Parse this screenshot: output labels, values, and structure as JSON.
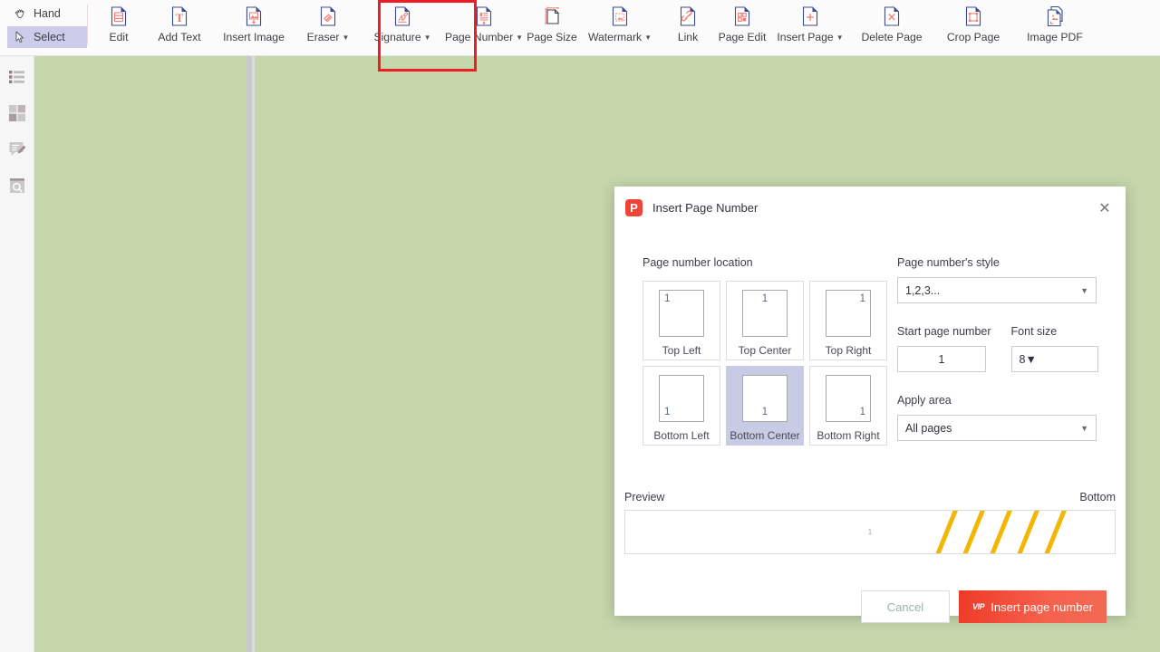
{
  "toolbar": {
    "modes": [
      {
        "label": "Hand",
        "icon": "hand-icon",
        "active": false
      },
      {
        "label": "Select",
        "icon": "cursor-arrow-icon",
        "active": true
      }
    ],
    "tools": [
      {
        "label": "Edit",
        "icon": "edit-document-icon",
        "caret": false
      },
      {
        "label": "Add Text",
        "icon": "add-text-icon",
        "caret": false
      },
      {
        "label": "Insert Image",
        "icon": "insert-image-icon",
        "caret": false
      },
      {
        "label": "Eraser",
        "icon": "eraser-icon",
        "caret": true
      },
      {
        "label": "Signature",
        "icon": "signature-icon",
        "caret": true
      },
      {
        "label": "Page Number",
        "icon": "page-number-icon",
        "caret": true
      },
      {
        "label": "Page Size",
        "icon": "page-size-icon",
        "caret": false
      },
      {
        "label": "Watermark",
        "icon": "watermark-icon",
        "caret": true
      },
      {
        "label": "Link",
        "icon": "link-icon",
        "caret": false
      },
      {
        "label": "Page Edit",
        "icon": "page-edit-icon",
        "caret": false
      },
      {
        "label": "Insert Page",
        "icon": "insert-page-icon",
        "caret": true
      },
      {
        "label": "Delete Page",
        "icon": "delete-page-icon",
        "caret": false
      },
      {
        "label": "Crop Page",
        "icon": "crop-page-icon",
        "caret": false
      },
      {
        "label": "Image PDF",
        "icon": "image-pdf-icon",
        "caret": false
      }
    ],
    "highlight_color": "#ee1c25"
  },
  "sidebar_rail": {
    "items": [
      {
        "icon": "outline-list-icon"
      },
      {
        "icon": "thumbnail-grid-icon"
      },
      {
        "icon": "annotation-edit-icon"
      },
      {
        "icon": "search-page-icon"
      }
    ]
  },
  "dialog": {
    "app_badge": "P",
    "title": "Insert Page Number",
    "close_label": "✕",
    "location": {
      "label": "Page number location",
      "cells": [
        {
          "caption": "Top Left",
          "num": "1",
          "pos": "p-tl",
          "selected": false
        },
        {
          "caption": "Top Center",
          "num": "1",
          "pos": "p-tc",
          "selected": false
        },
        {
          "caption": "Top Right",
          "num": "1",
          "pos": "p-tr",
          "selected": false
        },
        {
          "caption": "Bottom Left",
          "num": "1",
          "pos": "p-bl",
          "selected": false
        },
        {
          "caption": "Bottom Center",
          "num": "1",
          "pos": "p-bc",
          "selected": true
        },
        {
          "caption": "Bottom Right",
          "num": "1",
          "pos": "p-br",
          "selected": false
        }
      ]
    },
    "style": {
      "label": "Page number's style",
      "value": "1,2,3..."
    },
    "start_page": {
      "label": "Start page number",
      "value": "1"
    },
    "font_size": {
      "label": "Font size",
      "value": "8"
    },
    "apply_area": {
      "label": "Apply area",
      "value": "All pages"
    },
    "preview": {
      "label": "Preview",
      "position_label": "Bottom",
      "page_mark": "1",
      "stripe_color": "#f2b705",
      "stripe_count": 5
    },
    "cancel_label": "Cancel",
    "primary_label": "Insert page number",
    "primary_badge": "VIP",
    "primary_color": "#f0422c"
  },
  "canvas": {
    "background_color": "#c5d6ab"
  }
}
